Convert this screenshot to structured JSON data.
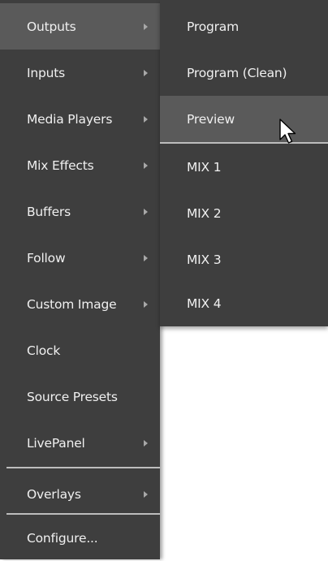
{
  "main_menu": {
    "items": [
      {
        "label": "Outputs",
        "has_submenu": true,
        "active": true
      },
      {
        "label": "Inputs",
        "has_submenu": true
      },
      {
        "label": "Media Players",
        "has_submenu": true
      },
      {
        "label": "Mix Effects",
        "has_submenu": true
      },
      {
        "label": "Buffers",
        "has_submenu": true
      },
      {
        "label": "Follow",
        "has_submenu": true
      },
      {
        "label": "Custom Image",
        "has_submenu": true
      },
      {
        "label": "Clock",
        "has_submenu": false
      },
      {
        "label": "Source Presets",
        "has_submenu": false
      },
      {
        "label": "LivePanel",
        "has_submenu": true
      },
      {
        "label": "Overlays",
        "has_submenu": true
      },
      {
        "label": "Configure...",
        "has_submenu": false
      }
    ]
  },
  "submenu": {
    "items": [
      {
        "label": "Program"
      },
      {
        "label": "Program (Clean)"
      },
      {
        "label": "Preview",
        "hovered": true
      },
      {
        "label": "MIX 1"
      },
      {
        "label": "MIX 2"
      },
      {
        "label": "MIX 3"
      },
      {
        "label": "MIX 4"
      }
    ]
  },
  "colors": {
    "menu_background": "#3e3e3e",
    "highlight_background": "#5a5a5a",
    "text": "#f0f0f0",
    "separator": "#bdbdbd",
    "arrow": "#a8a8a8"
  },
  "icons": {
    "submenu_arrow": "chevron-right-icon",
    "pointer": "mouse-pointer-icon"
  }
}
